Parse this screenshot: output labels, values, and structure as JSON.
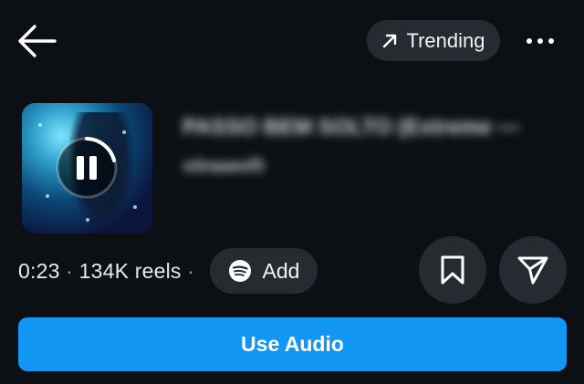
{
  "header": {
    "back_icon": "arrow-left-icon",
    "trending_label": "Trending",
    "trending_icon": "arrow-up-right-icon",
    "more_icon": "more-horizontal-icon"
  },
  "track": {
    "title_obscured": "PASSO BEM SOLTO (Extreme — slowed)",
    "playback_state": "playing",
    "pause_icon": "pause-icon",
    "progress_ring": 0.3
  },
  "meta": {
    "duration": "0:23",
    "separator": "·",
    "reels_count": "134K reels"
  },
  "add": {
    "label": "Add",
    "icon": "spotify-icon"
  },
  "actions": {
    "save_icon": "bookmark-icon",
    "share_icon": "send-icon"
  },
  "primary": {
    "label": "Use Audio"
  },
  "colors": {
    "background": "#0c1015",
    "chip": "#262b31",
    "accent": "#1196f3",
    "text": "#ffffff"
  }
}
